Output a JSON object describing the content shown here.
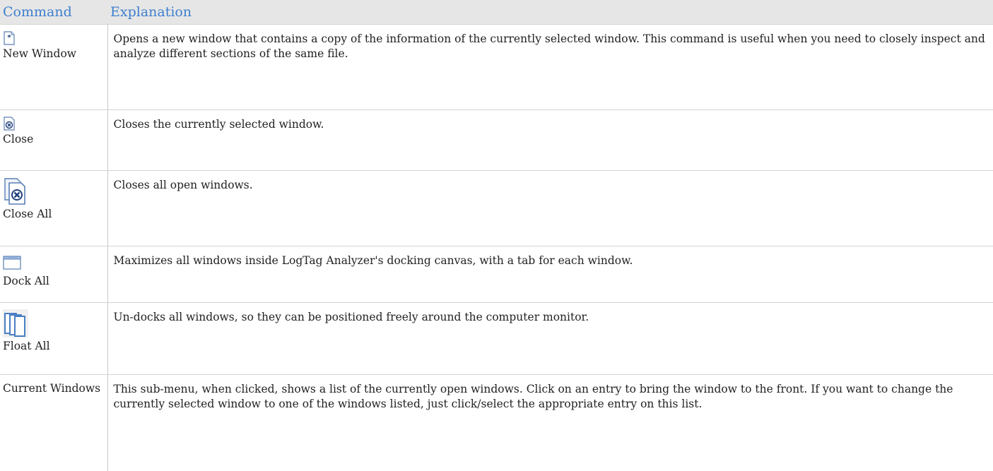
{
  "table": {
    "headers": {
      "command": "Command",
      "explanation": "Explanation"
    },
    "rows": [
      {
        "icon": "new-window-icon",
        "command": "New Window",
        "explanation": "Opens a new window that contains a copy of the information of the currently selected window. This command is useful when you need to closely inspect and analyze different sections of the same file."
      },
      {
        "icon": "close-window-icon",
        "command": "Close",
        "explanation": "Closes the currently selected window."
      },
      {
        "icon": "close-all-icon",
        "command": "Close All",
        "explanation": "Closes all open windows."
      },
      {
        "icon": "dock-all-icon",
        "command": "Dock All",
        "explanation": "Maximizes all windows inside LogTag Analyzer's docking canvas, with a tab for each window."
      },
      {
        "icon": "float-all-icon",
        "command": "Float All",
        "explanation": "Un-docks all windows, so they can be positioned freely around the computer monitor."
      },
      {
        "icon": "",
        "command": "Current Windows",
        "explanation": "This sub-menu, when clicked, shows a list of the currently open windows. Click on an entry to bring the window to the front. If you want to change the currently selected window to one of the windows listed, just click/select the appropriate entry on this list."
      }
    ]
  },
  "colors": {
    "header_bg": "#e6e6e6",
    "header_text": "#3d7fcf",
    "icon_blue": "#4a7fc4"
  }
}
